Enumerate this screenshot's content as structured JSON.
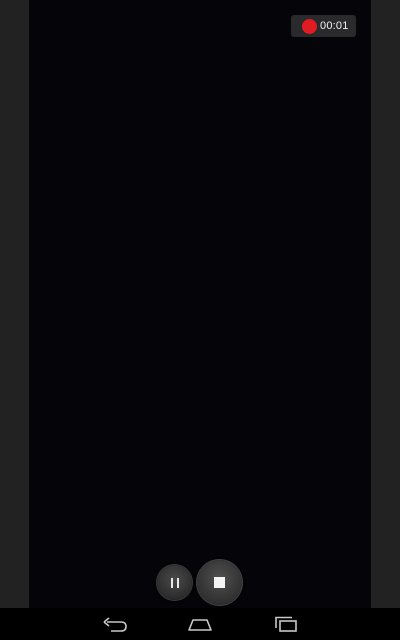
{
  "recording": {
    "indicator_icon": "record-dot-icon",
    "indicator_color": "#e01b22",
    "elapsed_time": "00:01"
  },
  "controls": {
    "pause_icon": "pause-icon",
    "stop_icon": "stop-icon"
  },
  "navbar": {
    "back_icon": "back-icon",
    "home_icon": "home-icon",
    "recent_apps_icon": "recent-apps-icon"
  },
  "colors": {
    "viewfinder_bg": "#050409",
    "side_bg": "#222222",
    "icon_color": "#e8e8e8"
  }
}
